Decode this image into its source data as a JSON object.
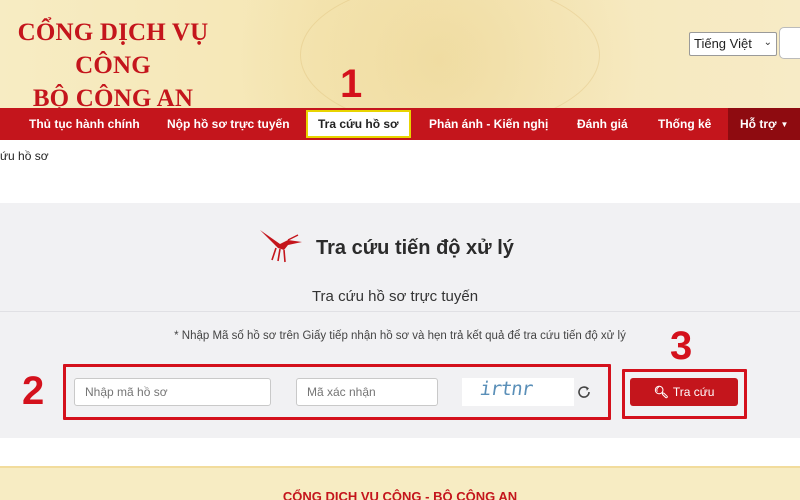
{
  "header": {
    "title_line1": "CỔNG DỊCH VỤ CÔNG",
    "title_line2": "BỘ CÔNG AN",
    "language": "Tiếng Việt"
  },
  "nav": {
    "items": [
      {
        "label": "Thủ tục hành chính"
      },
      {
        "label": "Nộp hồ sơ trực tuyến"
      },
      {
        "label": "Tra cứu hồ sơ"
      },
      {
        "label": "Phản ánh - Kiến nghị"
      },
      {
        "label": "Đánh giá"
      },
      {
        "label": "Thống kê"
      },
      {
        "label": "Hỗ trợ"
      }
    ]
  },
  "breadcrumb": "ứu hồ sơ",
  "lookup": {
    "title": "Tra cứu tiến độ xử lý",
    "subtitle": "Tra cứu hồ sơ trực tuyến",
    "instruction": "* Nhập Mã số hồ sơ trên Giấy tiếp nhận hồ sơ và hẹn trả kết quả để tra cứu tiến độ xử lý",
    "code_placeholder": "Nhập mã hồ sơ",
    "captcha_placeholder": "Mã xác nhận",
    "captcha_text": "irtnr",
    "search_label": "Tra cứu"
  },
  "annotations": {
    "step1": "1",
    "step2": "2",
    "step3": "3"
  },
  "footer": {
    "title": "CỔNG DỊCH VỤ CÔNG - BỘ CÔNG AN"
  },
  "colors": {
    "brand_red": "#c4151c",
    "header_bg": "#f7ecc3",
    "highlight_yellow": "#e8d400"
  }
}
